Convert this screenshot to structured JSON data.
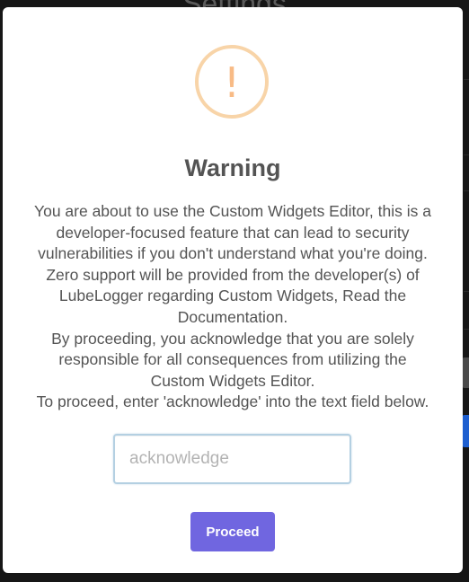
{
  "background": {
    "page_title": "Settings"
  },
  "dialog": {
    "icon": "warning-icon",
    "icon_glyph": "!",
    "title": "Warning",
    "message_lines": [
      "You are about to use the Custom Widgets Editor, this is a",
      "developer-focused feature that can lead to security",
      "vulnerabilities if you don't understand what you're doing.",
      "Zero support will be provided from the developer(s) of",
      "LubeLogger regarding Custom Widgets, Read the",
      "Documentation.",
      "By proceeding, you acknowledge that you are solely",
      "responsible for all consequences from utilizing the",
      "Custom Widgets Editor.",
      "To proceed, enter 'acknowledge' into the text field below."
    ],
    "input": {
      "value": "",
      "placeholder": "acknowledge"
    },
    "confirm_label": "Proceed"
  },
  "colors": {
    "warning_icon": "#f8bb86",
    "confirm_button": "#7066e0",
    "text": "#545454"
  }
}
